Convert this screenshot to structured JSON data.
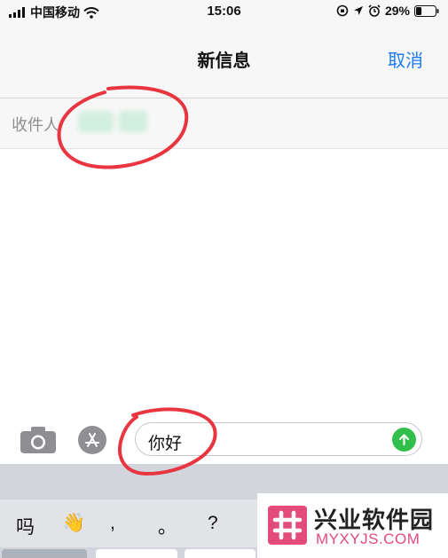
{
  "status_bar": {
    "carrier": "中国移动",
    "time": "15:06",
    "battery_percent": "29%",
    "battery_level": 0.29
  },
  "nav": {
    "title": "新信息",
    "cancel_label": "取消"
  },
  "recipient": {
    "label": "收件人"
  },
  "composer": {
    "message_text": "你好"
  },
  "keyboard": {
    "candidates": [
      "吗",
      "👋",
      ",",
      "。",
      "?"
    ]
  },
  "watermark": {
    "name_cn": "兴业软件园",
    "name_en": "MYXYJS.COM"
  },
  "colors": {
    "accent_blue": "#1a7cf5",
    "send_green": "#2fbf4a",
    "annotation_red": "#e8353f",
    "watermark_pink": "#e34b7a"
  }
}
